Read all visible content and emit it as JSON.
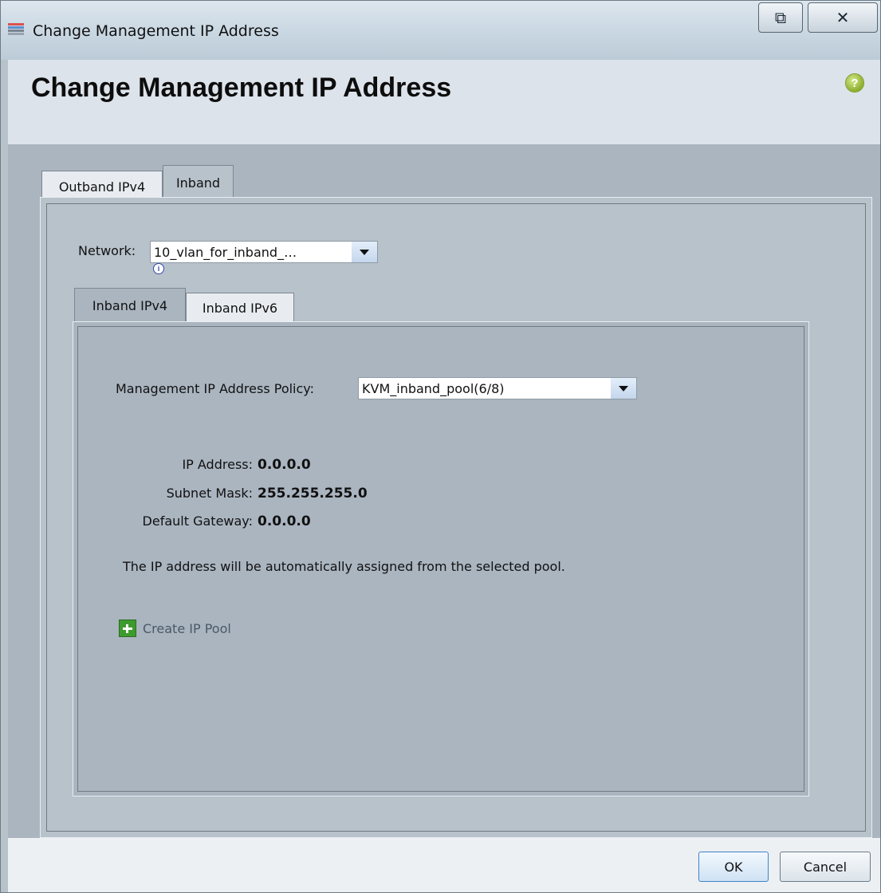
{
  "window": {
    "title": "Change Management IP Address",
    "restore_glyph": "⧉",
    "close_glyph": "✕"
  },
  "header": {
    "title": "Change Management IP Address",
    "help_glyph": "?"
  },
  "outer_tabs": [
    {
      "label": "Outband IPv4",
      "active": false
    },
    {
      "label": "Inband",
      "active": true
    }
  ],
  "network": {
    "label": "Network:",
    "value": "10_vlan_for_inband_…"
  },
  "inner_tabs": [
    {
      "label": "Inband IPv4",
      "active": true
    },
    {
      "label": "Inband IPv6",
      "active": false
    }
  ],
  "policy": {
    "label": "Management IP Address Policy:",
    "value": "KVM_inband_pool(6/8)"
  },
  "details": {
    "ip_label": "IP Address:",
    "ip_value": "0.0.0.0",
    "mask_label": "Subnet Mask:",
    "mask_value": "255.255.255.0",
    "gateway_label": "Default Gateway:",
    "gateway_value": "0.0.0.0"
  },
  "note": "The IP address will be automatically assigned from the selected pool.",
  "create_pool_label": "Create IP Pool",
  "footer": {
    "ok_label": "OK",
    "cancel_label": "Cancel"
  },
  "icons": {
    "app": "app-window-icon",
    "help": "help-icon",
    "info": "info-icon",
    "add": "plus-icon"
  },
  "colors": {
    "panel": "#b8c2cb",
    "header_band": "#dde3ea",
    "add_icon": "#3d9b2e",
    "ok_border": "#3f82c6"
  }
}
